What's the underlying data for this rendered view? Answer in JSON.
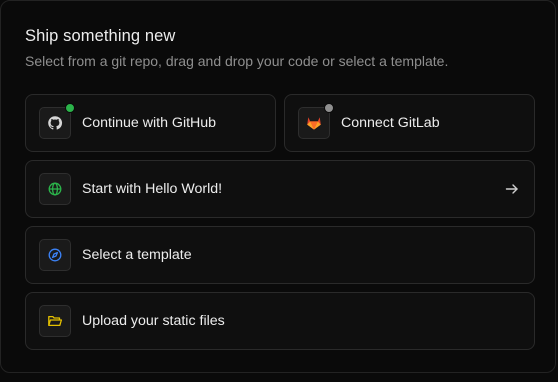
{
  "header": {
    "title": "Ship something new",
    "subtitle": "Select from a git repo, drag and drop your code or select a template."
  },
  "options": {
    "github": {
      "label": "Continue with GitHub",
      "icon": "github-icon",
      "status_color": "#2bb34a"
    },
    "gitlab": {
      "label": "Connect GitLab",
      "icon": "gitlab-icon",
      "status_color": "#8f8f8f"
    },
    "hello_world": {
      "label": "Start with Hello World!",
      "icon": "globe-icon",
      "action_icon": "arrow-right-icon"
    },
    "template": {
      "label": "Select a template",
      "icon": "compass-icon"
    },
    "upload": {
      "label": "Upload your static files",
      "icon": "folder-icon"
    }
  },
  "colors": {
    "background": "#0a0a0a",
    "card": "#0f0f0f",
    "border": "#2a2a2a",
    "text": "#ededed",
    "muted": "#8f8f8f",
    "github_dot": "#2bb34a",
    "gitlab_orange": "#e2432a",
    "globe_green": "#2bb34a",
    "compass_blue": "#3b82f6",
    "folder_yellow": "#e5c100"
  }
}
